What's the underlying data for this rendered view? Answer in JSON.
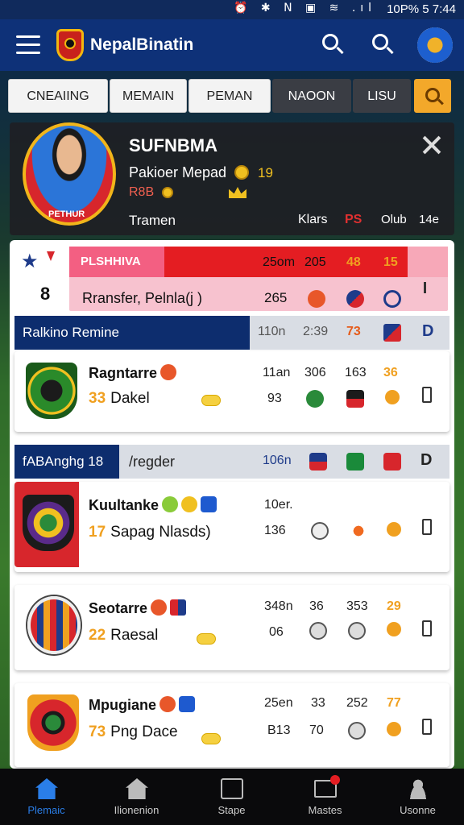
{
  "status_bar": {
    "icons": "⏰ ✱ N ▣ ≋ .ıl",
    "battery_time": "10P% 5 7:44"
  },
  "app_bar": {
    "title": "NepalBinatin"
  },
  "tabs": [
    {
      "label": "CNEAIING"
    },
    {
      "label": "MEMAIN"
    },
    {
      "label": "PEMAN"
    },
    {
      "label": "NAOON"
    },
    {
      "label": "LISU"
    }
  ],
  "profile": {
    "name": "SUFNBMA",
    "role": "Pakioer Mepad",
    "number": "19",
    "code": "R8B",
    "team": "Tramen",
    "klars": "Klars",
    "ps": "PS",
    "club": "Olub",
    "age": "14e",
    "shirt_text": "PETHUR"
  },
  "banner": {
    "title": "PLSHHIVA",
    "cells": [
      "25om",
      "205",
      "48",
      "15"
    ],
    "rank": "8",
    "transfer": "Rransfer, Pelnla(j )",
    "stat": "265"
  },
  "section1": {
    "title": "Ralkino Remine",
    "cells": [
      "110n",
      "2:39",
      "73",
      "D"
    ]
  },
  "section2": {
    "title": "fABAnghg 18",
    "subtitle": "/regder",
    "cells": [
      "106n",
      "D"
    ]
  },
  "teams": [
    {
      "name": "Ragntarre",
      "rank": "33",
      "sub": "Dakel",
      "c1": "11an",
      "c2": "306",
      "c3": "163",
      "c4": "36",
      "c5": "93"
    },
    {
      "name": "Kuultanke",
      "rank": "17",
      "sub": "Sapag Nlasds)",
      "c1": "10er.",
      "c5": "136"
    },
    {
      "name": "Seotarre",
      "rank": "22",
      "sub": "Raesal",
      "c1": "348n",
      "c2": "36",
      "c3": "353",
      "c4": "29",
      "c5": "06"
    },
    {
      "name": "Mpugiane",
      "rank": "73",
      "sub": "Png Dace",
      "c1": "25en",
      "c2": "33",
      "c3": "252",
      "c4": "77",
      "c5": "B13",
      "c6": "70"
    }
  ],
  "bottom_nav": [
    {
      "label": "Plemaic"
    },
    {
      "label": "Ilionenion"
    },
    {
      "label": "Stape"
    },
    {
      "label": "Mastes"
    },
    {
      "label": "Usonne"
    }
  ],
  "colors": {
    "primary": "#0e3178",
    "accent": "#f0a020",
    "red": "#e41d22",
    "active_nav": "#2a7ee8"
  }
}
